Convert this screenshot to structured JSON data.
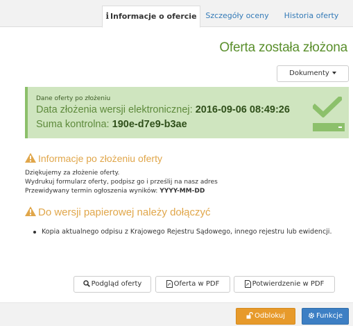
{
  "tabs": [
    {
      "label": "Informacje o ofercie",
      "active": true
    },
    {
      "label": "Szczegóły oceny",
      "active": false
    },
    {
      "label": "Historia oferty",
      "active": false
    }
  ],
  "header": {
    "title": "Oferta została złożona",
    "documents_button": "Dokumenty"
  },
  "summary": {
    "caption": "Dane oferty po złożeniu",
    "date_label": "Data złożenia wersji elektronicznej:",
    "date_value": "2016-09-06 08:49:26",
    "checksum_label": "Suma kontrolna:",
    "checksum_value": "190e-d7e9-b3ae"
  },
  "info": {
    "heading": "Informacje po złożeniu oferty",
    "line1": "Dziękujemy za złożenie oferty.",
    "line2": "Wydrukuj formularz oferty, podpisz go i prześlij na nasz adres",
    "line3_label": "Przewidywany termin ogłoszenia wyników:",
    "line3_value": "YYYY-MM-DD"
  },
  "attach": {
    "heading": "Do wersji papierowej należy dołączyć",
    "items": [
      "Kopia aktualnego odpisu z Krajowego Rejestru Sądowego, innego rejestru lub ewidencji."
    ]
  },
  "actions": {
    "preview": "Podgląd oferty",
    "offer_pdf": "Oferta w PDF",
    "confirmation_pdf": "Potwierdzenie w PDF"
  },
  "footer": {
    "unlock": "Odblokuj",
    "functions": "Funkcje"
  },
  "colors": {
    "accent_green": "#5a8f2c",
    "panel_bg": "#cfe5bf",
    "warning": "#e0a64a",
    "orange_button": "#e79a2b",
    "blue_button": "#3d7fc4",
    "link": "#337ab7"
  }
}
